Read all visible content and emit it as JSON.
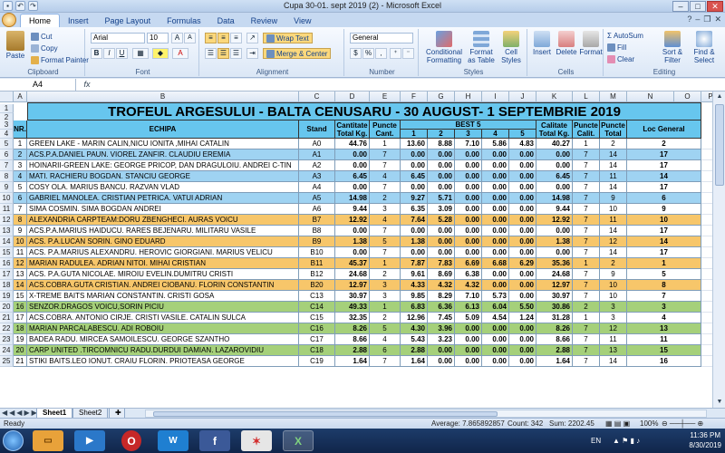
{
  "window": {
    "title": "Cupa 30-01. sept  2019 (2) - Microsoft Excel"
  },
  "tabs": [
    "Home",
    "Insert",
    "Page Layout",
    "Formulas",
    "Data",
    "Review",
    "View"
  ],
  "active_tab": "Home",
  "ribbon": {
    "clipboard": {
      "label": "Clipboard",
      "paste": "Paste",
      "cut": "Cut",
      "copy": "Copy",
      "format_painter": "Format Painter"
    },
    "font": {
      "label": "Font",
      "name": "Arial",
      "size": "10",
      "bold": "B",
      "italic": "I",
      "underline": "U"
    },
    "alignment": {
      "label": "Alignment",
      "wrap_text": "Wrap Text",
      "merge_center": "Merge & Center"
    },
    "number": {
      "label": "Number",
      "format": "General",
      "currency": "$",
      "percent": "%",
      "comma": ","
    },
    "styles": {
      "label": "Styles",
      "conditional": "Conditional Formatting",
      "format_table": "Format as Table",
      "cell_styles": "Cell Styles"
    },
    "cells": {
      "label": "Cells",
      "insert": "Insert",
      "delete": "Delete",
      "format": "Format"
    },
    "editing": {
      "label": "Editing",
      "autosum": "AutoSum",
      "fill": "Fill",
      "clear": "Clear",
      "sort_filter": "Sort & Filter",
      "find_select": "Find & Select"
    }
  },
  "name_box": "A4",
  "fx_label": "fx",
  "columns": [
    "A",
    "B",
    "C",
    "D",
    "E",
    "F",
    "G",
    "H",
    "I",
    "J",
    "K",
    "L",
    "M",
    "N",
    "O",
    "P"
  ],
  "sheet": {
    "title": "TROFEUL ARGESULUI  - BALTA CENUSARU - 30 AUGUST- 1 SEPTEMBRIE 2019",
    "headers": {
      "nr": "NR.",
      "echipa": "ECHIPA",
      "stand": "Stand",
      "cantitate": "Cantitate Total Kg.",
      "puncte_cant": "Puncte Cant.",
      "best5": "BEST 5",
      "best5_cols": [
        "1",
        "2",
        "3",
        "4",
        "5"
      ],
      "calitate": "Calitate Total Kg.",
      "puncte_calit": "Puncte Calit.",
      "puncte_total": "Puncte Total",
      "loc": "Loc General"
    },
    "rows": [
      {
        "nr": "1",
        "echipa": "GREEN LAKE - MARIN CALIN,NICU IONITA ,MIHAI  CATALIN",
        "stand": "A0",
        "cant": "44.76",
        "pc": "1",
        "b": [
          "13.60",
          "8.88",
          "7.10",
          "5.86",
          "4.83"
        ],
        "cal": "40.27",
        "pcal": "1",
        "pt": "2",
        "loc": "2"
      },
      {
        "nr": "2",
        "echipa": "ACS.P.A.DANIEL PAUN. VIOREL ZANFIR. CLAUDIU EREMIA",
        "stand": "A1",
        "cant": "0.00",
        "pc": "7",
        "b": [
          "0.00",
          "0.00",
          "0.00",
          "0.00",
          "0.00"
        ],
        "cal": "0.00",
        "pcal": "7",
        "pt": "14",
        "loc": "17"
      },
      {
        "nr": "3",
        "echipa": "HOINARII-GREEN LAKE: GEORGE  PRICOP, DAN DRAGULOIU. ANDREI C-TIN",
        "stand": "A2",
        "cant": "0.00",
        "pc": "7",
        "b": [
          "0.00",
          "0.00",
          "0.00",
          "0.00",
          "0.00"
        ],
        "cal": "0.00",
        "pcal": "7",
        "pt": "14",
        "loc": "17"
      },
      {
        "nr": "4",
        "echipa": "MATI. RACHIERU BOGDAN. STANCIU GEORGE",
        "stand": "A3",
        "cant": "6.45",
        "pc": "4",
        "b": [
          "6.45",
          "0.00",
          "0.00",
          "0.00",
          "0.00"
        ],
        "cal": "6.45",
        "pcal": "7",
        "pt": "11",
        "loc": "14"
      },
      {
        "nr": "5",
        "echipa": "COSY OLA. MARIUS BANCU. RAZVAN VLAD",
        "stand": "A4",
        "cant": "0.00",
        "pc": "7",
        "b": [
          "0.00",
          "0.00",
          "0.00",
          "0.00",
          "0.00"
        ],
        "cal": "0.00",
        "pcal": "7",
        "pt": "14",
        "loc": "17"
      },
      {
        "nr": "6",
        "echipa": "GABRIEL MANOLEA. CRISTIAN PETRICA. VATUI ADRIAN",
        "stand": "A5",
        "cant": "14.98",
        "pc": "2",
        "b": [
          "9.27",
          "5.71",
          "0.00",
          "0.00",
          "0.00"
        ],
        "cal": "14.98",
        "pcal": "7",
        "pt": "9",
        "loc": "6"
      },
      {
        "nr": "7",
        "echipa": "SIMA COSMIN.  SIMA BOGDAN ANDREI",
        "stand": "A6",
        "cant": "9.44",
        "pc": "3",
        "b": [
          "6.35",
          "3.09",
          "0.00",
          "0.00",
          "0.00"
        ],
        "cal": "9.44",
        "pcal": "7",
        "pt": "10",
        "loc": "9"
      },
      {
        "nr": "8",
        "echipa": "ALEXANDRIA CARPTEAM:DORU ZBENGHECI. AURAS VOICU",
        "stand": "B7",
        "cant": "12.92",
        "pc": "4",
        "b": [
          "7.64",
          "5.28",
          "0.00",
          "0.00",
          "0.00"
        ],
        "cal": "12.92",
        "pcal": "7",
        "pt": "11",
        "loc": "10"
      },
      {
        "nr": "9",
        "echipa": "ACS.P.A.MARIUS HAIDUCU. RARES BEJENARU. MILITARU VASILE",
        "stand": "B8",
        "cant": "0.00",
        "pc": "7",
        "b": [
          "0.00",
          "0.00",
          "0.00",
          "0.00",
          "0.00"
        ],
        "cal": "0.00",
        "pcal": "7",
        "pt": "14",
        "loc": "17"
      },
      {
        "nr": "10",
        "echipa": "ACS. P.A.LUCAN SORIN. GINO EDUARD",
        "stand": "B9",
        "cant": "1.38",
        "pc": "5",
        "b": [
          "1.38",
          "0.00",
          "0.00",
          "0.00",
          "0.00"
        ],
        "cal": "1.38",
        "pcal": "7",
        "pt": "12",
        "loc": "14"
      },
      {
        "nr": "11",
        "echipa": "ACS. P.A.MARIUS ALEXANDRU. HEROVIC GIORGIANI. MARIUS VELICU",
        "stand": "B10",
        "cant": "0.00",
        "pc": "7",
        "b": [
          "0.00",
          "0.00",
          "0.00",
          "0.00",
          "0.00"
        ],
        "cal": "0.00",
        "pcal": "7",
        "pt": "14",
        "loc": "17"
      },
      {
        "nr": "12",
        "echipa": "MARIAN RADULEA. ADRIAN NITOI. MIHAI CRISTIAN",
        "stand": "B11",
        "cant": "45.37",
        "pc": "1",
        "b": [
          "7.87",
          "7.83",
          "6.69",
          "6.68",
          "6.29"
        ],
        "cal": "35.36",
        "pcal": "1",
        "pt": "2",
        "loc": "1"
      },
      {
        "nr": "13",
        "echipa": "ACS. P.A.GUTA NICOLAE. MIROIU EVELIN.DUMITRU CRISTI",
        "stand": "B12",
        "cant": "24.68",
        "pc": "2",
        "b": [
          "9.61",
          "8.69",
          "6.38",
          "0.00",
          "0.00"
        ],
        "cal": "24.68",
        "pcal": "7",
        "pt": "9",
        "loc": "5"
      },
      {
        "nr": "14",
        "echipa": "ACS.COBRA.GUTA CRISTIAN. ANDREI CIOBANU. FLORIN CONSTANTIN",
        "stand": "B20",
        "cant": "12.97",
        "pc": "3",
        "b": [
          "4.33",
          "4.32",
          "4.32",
          "0.00",
          "0.00"
        ],
        "cal": "12.97",
        "pcal": "7",
        "pt": "10",
        "loc": "8"
      },
      {
        "nr": "15",
        "echipa": "X-TREME BAITS MARIAN CONSTANTIN. CRISTI GOSA",
        "stand": "C13",
        "cant": "30.97",
        "pc": "3",
        "b": [
          "9.85",
          "8.29",
          "7.10",
          "5.73",
          "0.00"
        ],
        "cal": "30.97",
        "pcal": "7",
        "pt": "10",
        "loc": "7"
      },
      {
        "nr": "16",
        "echipa": "SENZOR.DRAGOS VOICU,SORIN PICIU",
        "stand": "C14",
        "cant": "49.33",
        "pc": "1",
        "b": [
          "6.83",
          "6.36",
          "6.13",
          "6.04",
          "5.50"
        ],
        "cal": "30.86",
        "pcal": "2",
        "pt": "3",
        "loc": "3"
      },
      {
        "nr": "17",
        "echipa": "ACS.COBRA. ANTONIO CIRJE. CRISTI VASILE. CATALIN SULCA",
        "stand": "C15",
        "cant": "32.35",
        "pc": "2",
        "b": [
          "12.96",
          "7.45",
          "5.09",
          "4.54",
          "1.24"
        ],
        "cal": "31.28",
        "pcal": "1",
        "pt": "3",
        "loc": "4"
      },
      {
        "nr": "18",
        "echipa": "MARIAN PARCALABESCU. ADI ROBOIU",
        "stand": "C16",
        "cant": "8.26",
        "pc": "5",
        "b": [
          "4.30",
          "3.96",
          "0.00",
          "0.00",
          "0.00"
        ],
        "cal": "8.26",
        "pcal": "7",
        "pt": "12",
        "loc": "13"
      },
      {
        "nr": "19",
        "echipa": "BADEA RADU. MIRCEA SAMOILESCU. GEORGE SZANTHO",
        "stand": "C17",
        "cant": "8.66",
        "pc": "4",
        "b": [
          "5.43",
          "3.23",
          "0.00",
          "0.00",
          "0.00"
        ],
        "cal": "8.66",
        "pcal": "7",
        "pt": "11",
        "loc": "11"
      },
      {
        "nr": "20",
        "echipa": "CARP UNITED .TIRCOMNICU RADU.DURDUI DAMIAN. LAZAROVIDIU",
        "stand": "C18",
        "cant": "2.88",
        "pc": "6",
        "b": [
          "2.88",
          "0.00",
          "0.00",
          "0.00",
          "0.00"
        ],
        "cal": "2.88",
        "pcal": "7",
        "pt": "13",
        "loc": "15"
      },
      {
        "nr": "21",
        "echipa": "STIKI BAITS.LEO IONUT. CRAIU FLORIN. PRIOTEASA GEORGE",
        "stand": "C19",
        "cant": "1.64",
        "pc": "7",
        "b": [
          "1.64",
          "0.00",
          "0.00",
          "0.00",
          "0.00"
        ],
        "cal": "1.64",
        "pcal": "7",
        "pt": "14",
        "loc": "16"
      }
    ],
    "row_numbers": [
      "1",
      "2",
      "3",
      "4",
      "5",
      "6",
      "7",
      "8",
      "9",
      "10",
      "11",
      "12",
      "13",
      "14",
      "15",
      "16",
      "17",
      "18",
      "19",
      "20",
      "21",
      "22",
      "23",
      "24",
      "25"
    ]
  },
  "row_colors": {
    "blue": "#9fd3f2",
    "white": "#ffffff",
    "yellow": "#f7c66a",
    "green": "#a5d07a"
  },
  "sheet_tabs": [
    "Sheet1",
    "Sheet2"
  ],
  "status": {
    "ready": "Ready",
    "average": "Average: 7.865892857",
    "count": "Count: 342",
    "sum": "Sum: 2202.45",
    "zoom": "100%"
  },
  "taskbar": {
    "lang": "EN",
    "time": "11:36 PM",
    "date": "8/30/2019"
  }
}
